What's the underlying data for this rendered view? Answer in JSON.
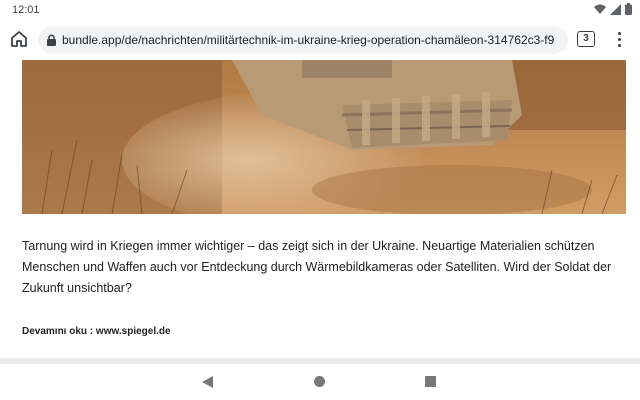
{
  "status_bar": {
    "time": "12:01"
  },
  "browser": {
    "url": "bundle.app/de/nachrichten/militärtechnik-im-ukraine-krieg-operation-chamäleon-314762c3-f9",
    "tab_count": "3",
    "icons": [
      "home-icon",
      "lock-icon",
      "tab-switcher-icon",
      "more-menu-icon"
    ]
  },
  "article": {
    "hero_image": "camouflaged tank driving through dusty desert terrain",
    "paragraph": "Tarnung wird in Kriegen immer wichtiger – das zeigt sich in der Ukraine. Neuartige Materialien schützen Menschen und Waffen auch vor Entdeckung durch Wärmebildkameras oder Satelliten. Wird der Soldat der Zukunft unsichtbar?",
    "more_label": "Devamını oku :",
    "more_source": "www.spiegel.de"
  },
  "navigation": {
    "icons": [
      "back-icon",
      "home-icon",
      "recent-apps-icon"
    ]
  },
  "colors": {
    "url_bar_bg": "#f1f3f4",
    "text": "#222222",
    "nav_icon": "#777777"
  }
}
